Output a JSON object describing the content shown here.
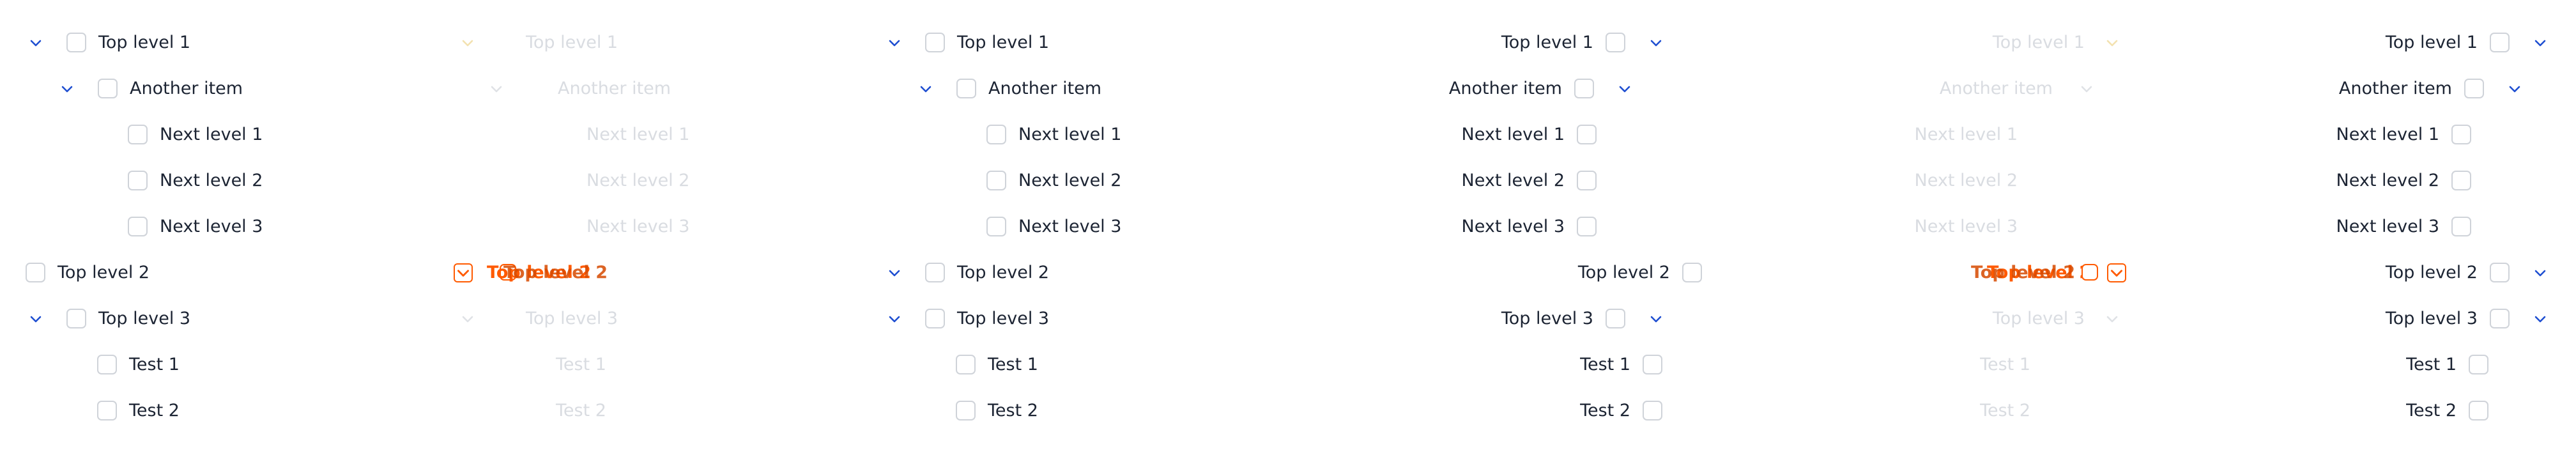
{
  "tree_labels": {
    "top_level_1": "Top level 1",
    "another_item": "Another item",
    "next_level_1": "Next level 1",
    "next_level_2": "Next level 2",
    "next_level_3": "Next level 3",
    "top_level_2": "Top level 2",
    "top_level_3": "Top level 3",
    "test_1": "Test 1",
    "test_2": "Test 2",
    "drag_ghost": "Top level 2"
  },
  "icons": {
    "expand": "chevron-down-icon",
    "checkbox": "checkbox-unchecked"
  },
  "colors": {
    "chevron": "#1f4fd1",
    "focus": "#ff5a00",
    "disabled_text": "#d9dce1"
  }
}
